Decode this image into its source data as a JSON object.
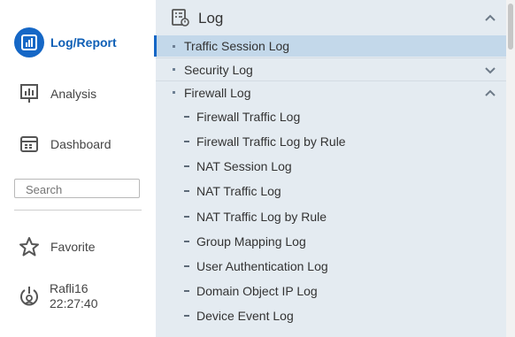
{
  "sidebar": {
    "items": [
      {
        "label": "Log/Report",
        "icon": "bar-chart-icon",
        "active": true
      },
      {
        "label": "Analysis",
        "icon": "analysis-icon"
      },
      {
        "label": "Dashboard",
        "icon": "dashboard-icon"
      }
    ],
    "search": {
      "placeholder": "Search"
    },
    "favorite": {
      "label": "Favorite",
      "icon": "star-icon"
    },
    "user": {
      "name": "Rafli16",
      "time": "22:27:40",
      "icon": "user-power-icon"
    }
  },
  "panel": {
    "title": "Log",
    "icon": "log-list-icon",
    "sections": [
      {
        "label": "Traffic Session Log",
        "selected": true
      },
      {
        "label": "Security Log",
        "expanded": false
      },
      {
        "label": "Firewall Log",
        "expanded": true
      }
    ],
    "firewall_items": [
      "Firewall Traffic Log",
      "Firewall Traffic Log by Rule",
      "NAT Session Log",
      "NAT Traffic Log",
      "NAT Traffic Log by Rule",
      "Group Mapping Log",
      "User Authentication Log",
      "Domain Object IP Log",
      "Device Event Log"
    ]
  },
  "colors": {
    "accent": "#1567c6",
    "panel_bg": "#e4ebf1",
    "selected_bg": "#c3d8ea"
  }
}
